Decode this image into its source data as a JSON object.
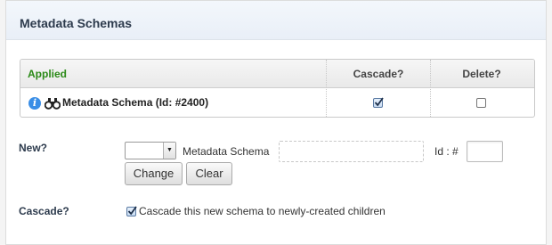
{
  "panel": {
    "title": "Metadata Schemas"
  },
  "table": {
    "headers": {
      "applied": "Applied",
      "cascade": "Cascade?",
      "delete": "Delete?"
    },
    "rows": [
      {
        "name": "Metadata Schema (Id: #2400)",
        "cascade": true,
        "delete": false
      }
    ]
  },
  "new_form": {
    "label": "New?",
    "select_value": "",
    "schema_label": "Metadata Schema",
    "schema_input_value": "",
    "id_label": "Id : #",
    "id_input_value": "",
    "change_button": "Change",
    "clear_button": "Clear"
  },
  "cascade_form": {
    "label": "Cascade?",
    "checkbox_label": "Cascade this new schema to newly-created children",
    "checked": true
  },
  "colors": {
    "accent_green": "#2b8a18",
    "header_text": "#2d3b4d",
    "info_blue": "#3a8ee6"
  },
  "icons": [
    "info-icon",
    "binoculars-icon",
    "checkbox-checked",
    "checkbox-unchecked",
    "chevron-down-icon"
  ]
}
